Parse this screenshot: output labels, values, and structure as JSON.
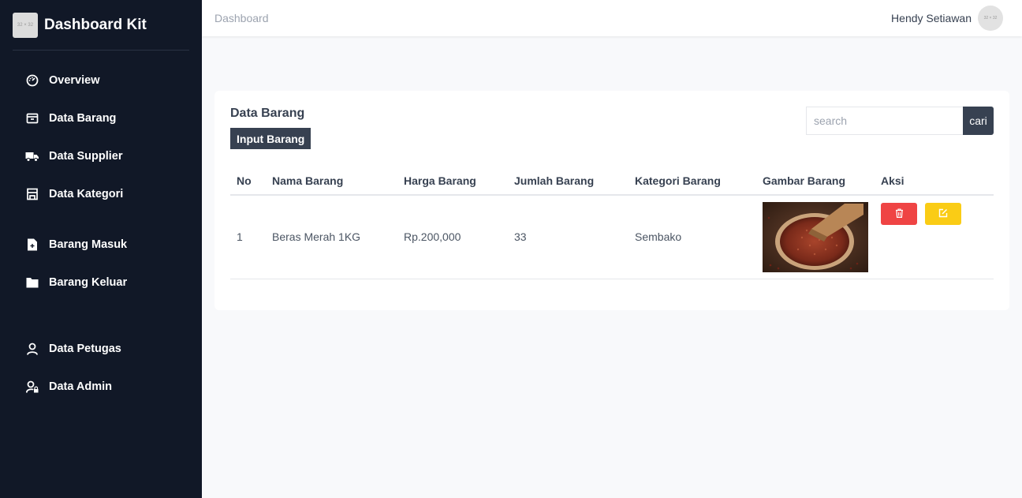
{
  "brand": {
    "title": "Dashboard Kit",
    "logo_text": "32 × 32"
  },
  "sidebar": {
    "items": [
      {
        "label": "Overview",
        "icon": "dashboard-gauge-icon"
      },
      {
        "label": "Data Barang",
        "icon": "archive-box-icon"
      },
      {
        "label": "Data Supplier",
        "icon": "truck-icon"
      },
      {
        "label": "Data Kategori",
        "icon": "store-icon"
      },
      {
        "label": "Barang Masuk",
        "icon": "file-plus-icon"
      },
      {
        "label": "Barang Keluar",
        "icon": "folder-icon"
      },
      {
        "label": "Data Petugas",
        "icon": "user-icon"
      },
      {
        "label": "Data Admin",
        "icon": "user-lock-icon"
      }
    ]
  },
  "header": {
    "breadcrumb": "Dashboard",
    "user_name": "Hendy Setiawan",
    "avatar_text": "32 × 32"
  },
  "card": {
    "title": "Data Barang",
    "input_button": "Input Barang",
    "search_placeholder": "search",
    "search_button": "cari"
  },
  "table": {
    "headers": [
      "No",
      "Nama Barang",
      "Harga Barang",
      "Jumlah Barang",
      "Kategori Barang",
      "Gambar Barang",
      "Aksi"
    ],
    "rows": [
      {
        "no": "1",
        "nama": "Beras Merah 1KG",
        "harga": "Rp.200,000",
        "jumlah": "33",
        "kategori": "Sembako",
        "gambar": "red-rice-photo",
        "actions": [
          "trash-icon",
          "edit-icon"
        ]
      }
    ]
  },
  "colors": {
    "sidebar_bg": "#111827",
    "accent_dark": "#374151",
    "delete": "#ef4444",
    "edit": "#facc15"
  }
}
